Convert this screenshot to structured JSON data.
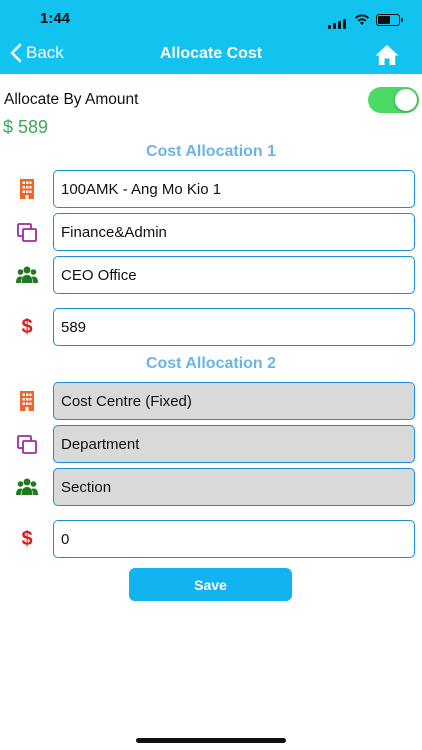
{
  "status_bar": {
    "time": "1:44"
  },
  "nav": {
    "back_label": "Back",
    "title": "Allocate Cost"
  },
  "allocate_by_amount": {
    "label": "Allocate By Amount",
    "enabled": true,
    "amount": "$ 589"
  },
  "allocation_1": {
    "title": "Cost Allocation 1",
    "cost_centre": "100AMK - Ang Mo Kio 1",
    "department": "Finance&Admin",
    "section": "CEO Office",
    "amount": "589"
  },
  "allocation_2": {
    "title": "Cost Allocation 2",
    "cost_centre": "Cost Centre (Fixed)",
    "department": "Department",
    "section": "Section",
    "amount": "0"
  },
  "icons": {
    "cost_centre": "building-icon",
    "department": "copy-icon",
    "section": "users-icon",
    "amount": "dollar-icon"
  },
  "dollar_symbol": "$",
  "save_label": "Save",
  "colors": {
    "header": "#12c2ef",
    "toggle_on": "#4cd964",
    "amount_green": "#3aaa5c",
    "section_title": "#6cb4e4",
    "field_border": "#1a8fd6",
    "building_icon": "#f0642a",
    "copy_icon": "#9b2d9b",
    "users_icon": "#1f7a1f",
    "dollar_icon": "#d91f1f",
    "save_button": "#12b4f0"
  }
}
